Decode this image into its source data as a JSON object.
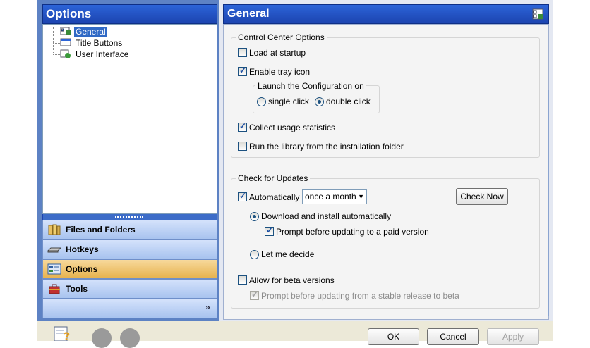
{
  "left_panel": {
    "title": "Options",
    "tree": [
      {
        "label": "General",
        "selected": true
      },
      {
        "label": "Title Buttons",
        "selected": false
      },
      {
        "label": "User Interface",
        "selected": false
      }
    ],
    "nav": [
      {
        "label": "Files and Folders",
        "icon": "folder-icon",
        "active": false
      },
      {
        "label": "Hotkeys",
        "icon": "keyboard-icon",
        "active": false
      },
      {
        "label": "Options",
        "icon": "options-icon",
        "active": true
      },
      {
        "label": "Tools",
        "icon": "tools-icon",
        "active": false
      }
    ],
    "chevron": "»"
  },
  "right_panel": {
    "title": "General",
    "control_center": {
      "legend": "Control Center Options",
      "load_at_startup": {
        "label": "Load at startup",
        "checked": false
      },
      "enable_tray_icon": {
        "label": "Enable tray icon",
        "checked": true
      },
      "launch": {
        "legend": "Launch the Configuration on",
        "single_click": "single click",
        "double_click": "double click",
        "selected": "double click"
      },
      "collect_usage": {
        "label": "Collect usage statistics",
        "checked": true
      },
      "run_library": {
        "label": "Run the library from the installation folder",
        "checked": false
      }
    },
    "updates": {
      "legend": "Check for Updates",
      "automatically": {
        "label": "Automatically",
        "checked": true
      },
      "frequency": "once a month",
      "check_now": "Check Now",
      "download_install": "Download and install automatically",
      "prompt_paid": {
        "label": "Prompt before updating to a paid version",
        "checked": true
      },
      "let_me_decide": "Let me decide",
      "selected": "Download and install automatically",
      "beta": {
        "label": "Allow for beta versions",
        "checked": false
      },
      "prompt_beta": {
        "label": "Prompt before updating from a stable release to beta",
        "checked": true,
        "disabled": true
      }
    }
  },
  "buttons": {
    "ok": "OK",
    "cancel": "Cancel",
    "apply": "Apply"
  },
  "colors": {
    "header_blue": "#2c64d8",
    "active_nav": "#e7b24d",
    "selection": "#316ac5"
  }
}
